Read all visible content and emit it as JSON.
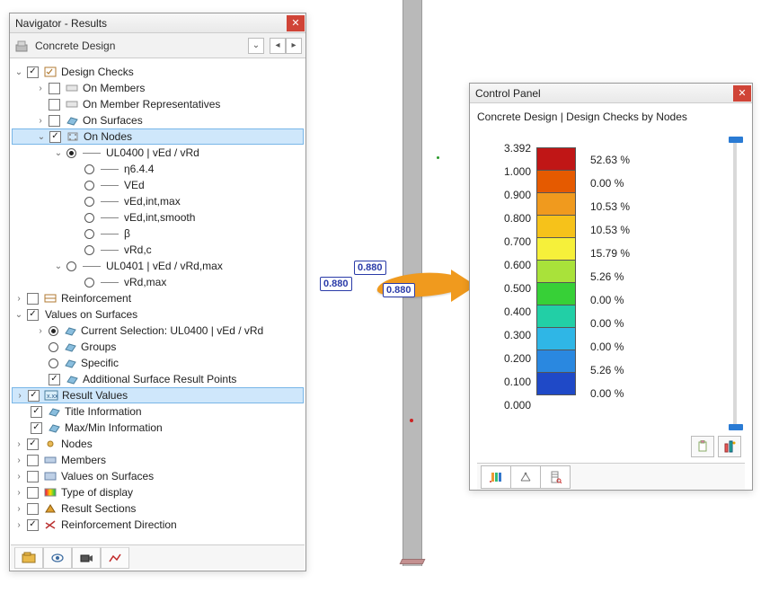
{
  "navigator": {
    "title": "Navigator - Results",
    "category": "Concrete Design",
    "tree": {
      "design_checks": "Design Checks",
      "on_members": "On Members",
      "on_member_reps": "On Member Representatives",
      "on_surfaces": "On Surfaces",
      "on_nodes": "On Nodes",
      "ul0400": "UL0400 | vEd / vRd",
      "eta": "η6.4.4",
      "ved": "VEd",
      "vedintmax": "vEd,int,max",
      "vedintsmooth": "vEd,int,smooth",
      "beta": "β",
      "vrdc": "vRd,c",
      "ul0401": "UL0401 | vEd / vRd,max",
      "vrdmax": "vRd,max",
      "reinforcement": "Reinforcement",
      "values_on_surfaces": "Values on Surfaces",
      "current_selection": "Current Selection: UL0400 | vEd / vRd",
      "groups": "Groups",
      "specific": "Specific",
      "addl_surface_pts": "Additional Surface Result Points",
      "result_values": "Result Values",
      "title_info": "Title Information",
      "maxmin": "Max/Min Information",
      "nodes": "Nodes",
      "members": "Members",
      "values_on_surfaces2": "Values on Surfaces",
      "type_of_display": "Type of display",
      "result_sections": "Result Sections",
      "reinf_direction": "Reinforcement Direction"
    }
  },
  "control_panel": {
    "title": "Control Panel",
    "subtitle": "Concrete Design | Design Checks by Nodes",
    "values": [
      "3.392",
      "1.000",
      "0.900",
      "0.800",
      "0.700",
      "0.600",
      "0.500",
      "0.400",
      "0.300",
      "0.200",
      "0.100",
      "0.000"
    ],
    "colors": [
      "#c01616",
      "#e55a00",
      "#f09a1e",
      "#f6c21a",
      "#f6f03a",
      "#a9e23a",
      "#37d037",
      "#22cfa6",
      "#2fb6e6",
      "#2a88e0",
      "#1f49c7",
      "#0a0a80"
    ],
    "percents": [
      "52.63 %",
      "0.00 %",
      "10.53 %",
      "10.53 %",
      "15.79 %",
      "5.26 %",
      "0.00 %",
      "0.00 %",
      "0.00 %",
      "5.26 %",
      "0.00 %"
    ]
  },
  "viewport": {
    "val1": "0.880",
    "val2": "0.880",
    "val3": "0.880"
  },
  "chart_data": {
    "type": "table",
    "title": "Concrete Design | Design Checks by Nodes — color scale",
    "thresholds": [
      3.392,
      1.0,
      0.9,
      0.8,
      0.7,
      0.6,
      0.5,
      0.4,
      0.3,
      0.2,
      0.1,
      0.0
    ],
    "bin_percent": [
      52.63,
      0.0,
      10.53,
      10.53,
      15.79,
      5.26,
      0.0,
      0.0,
      0.0,
      5.26,
      0.0
    ],
    "colors": [
      "#c01616",
      "#e55a00",
      "#f09a1e",
      "#f6c21a",
      "#f6f03a",
      "#a9e23a",
      "#37d037",
      "#22cfa6",
      "#2fb6e6",
      "#2a88e0",
      "#1f49c7",
      "#0a0a80"
    ]
  }
}
